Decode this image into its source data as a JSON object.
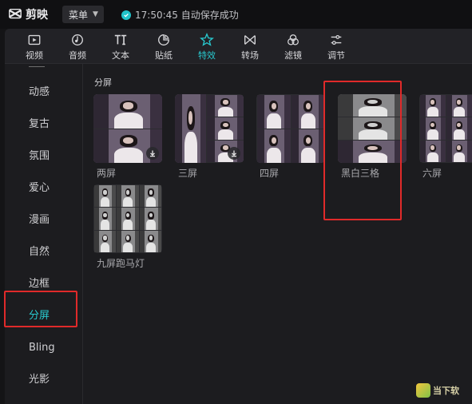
{
  "app": {
    "name": "剪映"
  },
  "titlebar": {
    "menu_label": "菜单",
    "save_status": "17:50:45 自动保存成功"
  },
  "toolbar": {
    "tools": [
      {
        "label": "视频",
        "icon": "video-icon"
      },
      {
        "label": "音频",
        "icon": "audio-icon"
      },
      {
        "label": "文本",
        "icon": "text-icon"
      },
      {
        "label": "贴纸",
        "icon": "sticker-icon"
      },
      {
        "label": "特效",
        "icon": "effects-icon",
        "active": true
      },
      {
        "label": "转场",
        "icon": "transition-icon"
      },
      {
        "label": "滤镜",
        "icon": "filter-icon"
      },
      {
        "label": "调节",
        "icon": "adjust-icon"
      }
    ]
  },
  "sidebar": {
    "items": [
      {
        "label": "动感"
      },
      {
        "label": "复古"
      },
      {
        "label": "氛围"
      },
      {
        "label": "爱心"
      },
      {
        "label": "漫画"
      },
      {
        "label": "自然"
      },
      {
        "label": "边框"
      },
      {
        "label": "分屏",
        "active": true
      },
      {
        "label": "Bling"
      },
      {
        "label": "光影"
      }
    ]
  },
  "content": {
    "section_title": "分屏",
    "effects": [
      {
        "label": "两屏",
        "style": "two"
      },
      {
        "label": "三屏",
        "style": "three"
      },
      {
        "label": "四屏",
        "style": "four"
      },
      {
        "label": "黑白三格",
        "style": "bw"
      },
      {
        "label": "六屏",
        "style": "six"
      },
      {
        "label": "九屏跑马灯",
        "style": "nine"
      }
    ]
  },
  "colors": {
    "accent": "#29c9cf",
    "highlight": "#e02a2a"
  },
  "watermark": {
    "text": "当下软"
  }
}
